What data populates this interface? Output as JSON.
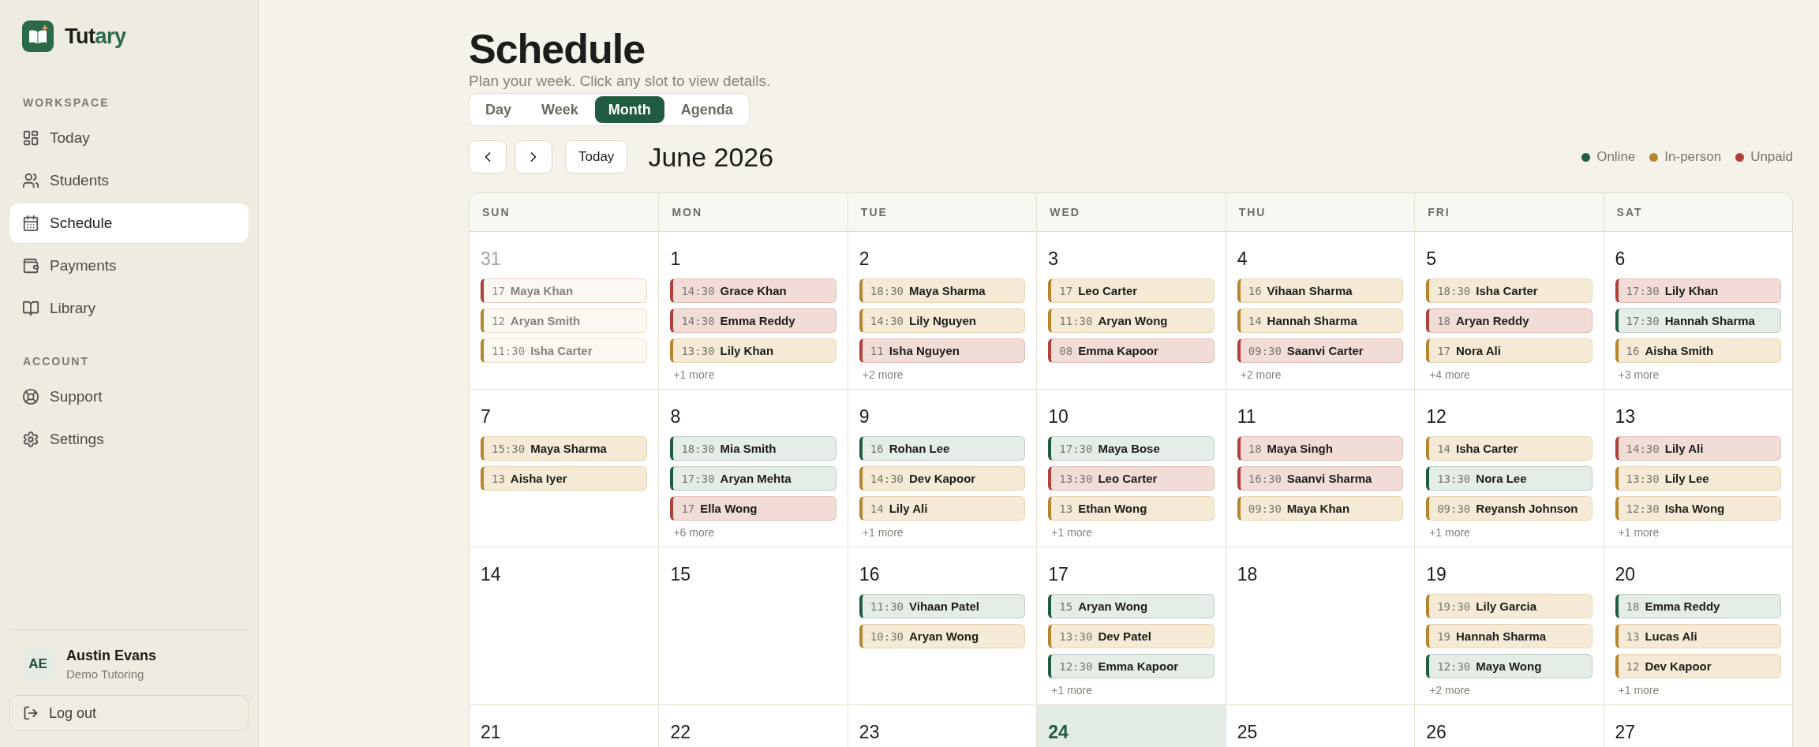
{
  "brand": {
    "text_dark": "Tut",
    "text_accent": "ary"
  },
  "sidebar": {
    "sections": [
      {
        "title": "WORKSPACE",
        "items": [
          {
            "label": "Today",
            "selected": false
          },
          {
            "label": "Students",
            "selected": false
          },
          {
            "label": "Schedule",
            "selected": true
          },
          {
            "label": "Payments",
            "selected": false
          },
          {
            "label": "Library",
            "selected": false
          }
        ]
      },
      {
        "title": "ACCOUNT",
        "items": [
          {
            "label": "Support",
            "selected": false
          },
          {
            "label": "Settings",
            "selected": false
          }
        ]
      }
    ],
    "user": {
      "initials": "AE",
      "name": "Austin Evans",
      "org": "Demo Tutoring"
    },
    "logout": "Log out"
  },
  "header": {
    "title": "Schedule",
    "subtitle": "Plan your week. Click any slot to view details."
  },
  "view_tabs": [
    {
      "label": "Day",
      "selected": false
    },
    {
      "label": "Week",
      "selected": false
    },
    {
      "label": "Month",
      "selected": true
    },
    {
      "label": "Agenda",
      "selected": false
    }
  ],
  "toolbar": {
    "today_button": "Today",
    "month": "June 2026"
  },
  "legend": [
    {
      "label": "Online",
      "color": "#1f5c40"
    },
    {
      "label": "In-person",
      "color": "#b8852f"
    },
    {
      "label": "Unpaid",
      "color": "#b0403a"
    }
  ],
  "calendar": {
    "weekdays": [
      "SUN",
      "MON",
      "TUE",
      "WED",
      "THU",
      "FRI",
      "SAT"
    ],
    "days": [
      {
        "date": "31",
        "outside_month": true,
        "today": false,
        "events": [
          {
            "time": "17",
            "name": "Maya Khan",
            "kind": "unpaid"
          },
          {
            "time": "12",
            "name": "Aryan Smith",
            "kind": "inperson"
          },
          {
            "time": "11:30",
            "name": "Isha Carter",
            "kind": "inperson"
          }
        ]
      },
      {
        "date": "1",
        "outside_month": false,
        "today": false,
        "events": [
          {
            "time": "14:30",
            "name": "Grace Khan",
            "kind": "unpaid"
          },
          {
            "time": "14:30",
            "name": "Emma Reddy",
            "kind": "unpaid"
          },
          {
            "time": "13:30",
            "name": "Lily Khan",
            "kind": "inperson"
          }
        ],
        "more": "+1 more"
      },
      {
        "date": "2",
        "outside_month": false,
        "today": false,
        "events": [
          {
            "time": "18:30",
            "name": "Maya Sharma",
            "kind": "inperson"
          },
          {
            "time": "14:30",
            "name": "Lily Nguyen",
            "kind": "inperson"
          },
          {
            "time": "11",
            "name": "Isha Nguyen",
            "kind": "unpaid"
          }
        ],
        "more": "+2 more"
      },
      {
        "date": "3",
        "outside_month": false,
        "today": false,
        "events": [
          {
            "time": "17",
            "name": "Leo Carter",
            "kind": "inperson"
          },
          {
            "time": "11:30",
            "name": "Aryan Wong",
            "kind": "inperson"
          },
          {
            "time": "08",
            "name": "Emma Kapoor",
            "kind": "unpaid"
          }
        ]
      },
      {
        "date": "4",
        "outside_month": false,
        "today": false,
        "events": [
          {
            "time": "16",
            "name": "Vihaan Sharma",
            "kind": "inperson"
          },
          {
            "time": "14",
            "name": "Hannah Sharma",
            "kind": "inperson"
          },
          {
            "time": "09:30",
            "name": "Saanvi Carter",
            "kind": "unpaid"
          }
        ],
        "more": "+2 more"
      },
      {
        "date": "5",
        "outside_month": false,
        "today": false,
        "events": [
          {
            "time": "18:30",
            "name": "Isha Carter",
            "kind": "inperson"
          },
          {
            "time": "18",
            "name": "Aryan Reddy",
            "kind": "unpaid"
          },
          {
            "time": "17",
            "name": "Nora Ali",
            "kind": "inperson"
          }
        ],
        "more": "+4 more"
      },
      {
        "date": "6",
        "outside_month": false,
        "today": false,
        "events": [
          {
            "time": "17:30",
            "name": "Lily Khan",
            "kind": "unpaid"
          },
          {
            "time": "17:30",
            "name": "Hannah Sharma",
            "kind": "online"
          },
          {
            "time": "16",
            "name": "Aisha Smith",
            "kind": "inperson"
          }
        ],
        "more": "+3 more"
      },
      {
        "date": "7",
        "outside_month": false,
        "today": false,
        "events": [
          {
            "time": "15:30",
            "name": "Maya Sharma",
            "kind": "inperson"
          },
          {
            "time": "13",
            "name": "Aisha Iyer",
            "kind": "inperson"
          }
        ]
      },
      {
        "date": "8",
        "outside_month": false,
        "today": false,
        "events": [
          {
            "time": "18:30",
            "name": "Mia Smith",
            "kind": "online"
          },
          {
            "time": "17:30",
            "name": "Aryan Mehta",
            "kind": "online"
          },
          {
            "time": "17",
            "name": "Ella Wong",
            "kind": "unpaid"
          }
        ],
        "more": "+6 more"
      },
      {
        "date": "9",
        "outside_month": false,
        "today": false,
        "events": [
          {
            "time": "16",
            "name": "Rohan Lee",
            "kind": "online"
          },
          {
            "time": "14:30",
            "name": "Dev Kapoor",
            "kind": "inperson"
          },
          {
            "time": "14",
            "name": "Lily Ali",
            "kind": "inperson"
          }
        ],
        "more": "+1 more"
      },
      {
        "date": "10",
        "outside_month": false,
        "today": false,
        "events": [
          {
            "time": "17:30",
            "name": "Maya Bose",
            "kind": "online"
          },
          {
            "time": "13:30",
            "name": "Leo Carter",
            "kind": "unpaid"
          },
          {
            "time": "13",
            "name": "Ethan Wong",
            "kind": "inperson"
          }
        ],
        "more": "+1 more"
      },
      {
        "date": "11",
        "outside_month": false,
        "today": false,
        "events": [
          {
            "time": "18",
            "name": "Maya Singh",
            "kind": "unpaid"
          },
          {
            "time": "16:30",
            "name": "Saanvi Sharma",
            "kind": "unpaid"
          },
          {
            "time": "09:30",
            "name": "Maya Khan",
            "kind": "inperson"
          }
        ]
      },
      {
        "date": "12",
        "outside_month": false,
        "today": false,
        "events": [
          {
            "time": "14",
            "name": "Isha Carter",
            "kind": "inperson"
          },
          {
            "time": "13:30",
            "name": "Nora Lee",
            "kind": "online"
          },
          {
            "time": "09:30",
            "name": "Reyansh Johnson",
            "kind": "inperson"
          }
        ],
        "more": "+1 more"
      },
      {
        "date": "13",
        "outside_month": false,
        "today": false,
        "events": [
          {
            "time": "14:30",
            "name": "Lily Ali",
            "kind": "unpaid"
          },
          {
            "time": "13:30",
            "name": "Lily Lee",
            "kind": "inperson"
          },
          {
            "time": "12:30",
            "name": "Isha Wong",
            "kind": "inperson"
          }
        ],
        "more": "+1 more"
      },
      {
        "date": "14",
        "outside_month": false,
        "today": false
      },
      {
        "date": "15",
        "outside_month": false,
        "today": false
      },
      {
        "date": "16",
        "outside_month": false,
        "today": false,
        "events": [
          {
            "time": "11:30",
            "name": "Vihaan Patel",
            "kind": "online"
          },
          {
            "time": "10:30",
            "name": "Aryan Wong",
            "kind": "inperson"
          }
        ]
      },
      {
        "date": "17",
        "outside_month": false,
        "today": false,
        "events": [
          {
            "time": "15",
            "name": "Aryan Wong",
            "kind": "online"
          },
          {
            "time": "13:30",
            "name": "Dev Patel",
            "kind": "inperson"
          },
          {
            "time": "12:30",
            "name": "Emma Kapoor",
            "kind": "online"
          }
        ],
        "more": "+1 more"
      },
      {
        "date": "18",
        "outside_month": false,
        "today": false
      },
      {
        "date": "19",
        "outside_month": false,
        "today": false,
        "events": [
          {
            "time": "19:30",
            "name": "Lily Garcia",
            "kind": "inperson"
          },
          {
            "time": "19",
            "name": "Hannah Sharma",
            "kind": "inperson"
          },
          {
            "time": "12:30",
            "name": "Maya Wong",
            "kind": "online"
          }
        ],
        "more": "+2 more"
      },
      {
        "date": "20",
        "outside_month": false,
        "today": false,
        "events": [
          {
            "time": "18",
            "name": "Emma Reddy",
            "kind": "online"
          },
          {
            "time": "13",
            "name": "Lucas Ali",
            "kind": "inperson"
          },
          {
            "time": "12",
            "name": "Dev Kapoor",
            "kind": "inperson"
          }
        ],
        "more": "+1 more"
      },
      {
        "date": "21",
        "outside_month": false,
        "today": false
      },
      {
        "date": "22",
        "outside_month": false,
        "today": false
      },
      {
        "date": "23",
        "outside_month": false,
        "today": false
      },
      {
        "date": "24",
        "outside_month": false,
        "today": true
      },
      {
        "date": "25",
        "outside_month": false,
        "today": false
      },
      {
        "date": "26",
        "outside_month": false,
        "today": false
      },
      {
        "date": "27",
        "outside_month": false,
        "today": false
      }
    ]
  }
}
